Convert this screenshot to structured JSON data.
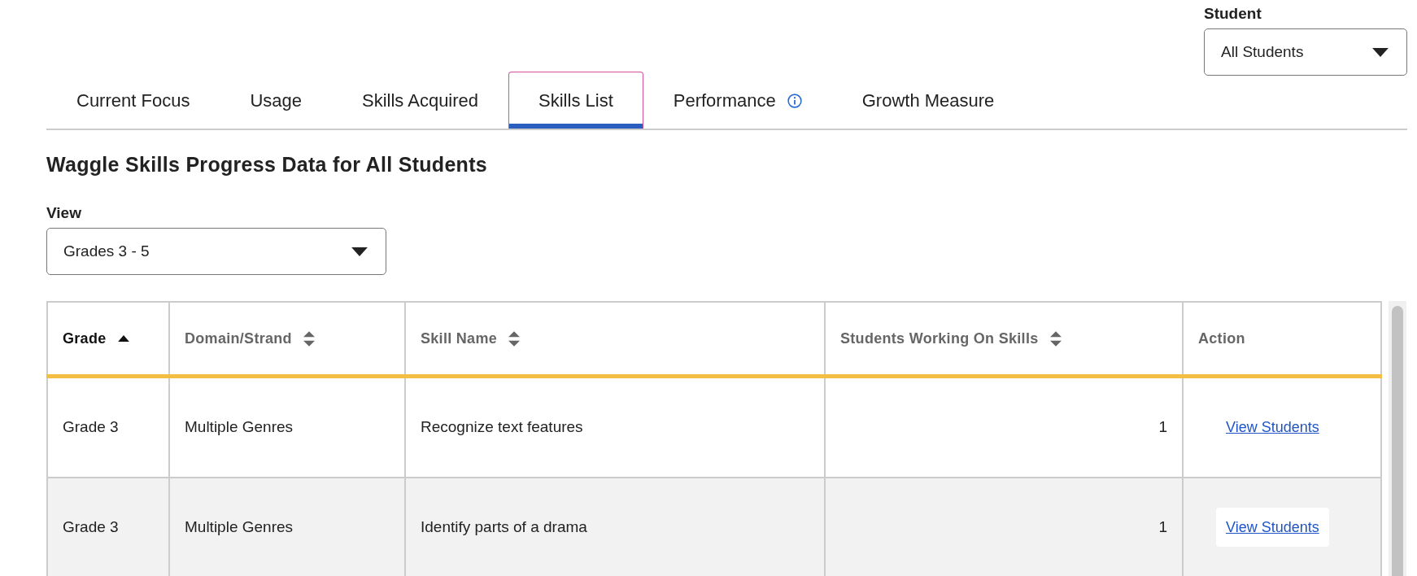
{
  "student_filter": {
    "label": "Student",
    "value": "All Students"
  },
  "tabs": [
    {
      "label": "Current Focus",
      "selected": false,
      "info": false
    },
    {
      "label": "Usage",
      "selected": false,
      "info": false
    },
    {
      "label": "Skills Acquired",
      "selected": false,
      "info": false
    },
    {
      "label": "Skills List",
      "selected": true,
      "info": false
    },
    {
      "label": "Performance",
      "selected": false,
      "info": true
    },
    {
      "label": "Growth Measure",
      "selected": false,
      "info": false
    }
  ],
  "heading": "Waggle Skills Progress Data for All Students",
  "view_filter": {
    "label": "View",
    "value": "Grades 3 - 5"
  },
  "table": {
    "columns": [
      {
        "label": "Grade",
        "sortable": true,
        "sorted": true
      },
      {
        "label": "Domain/Strand",
        "sortable": true,
        "sorted": false
      },
      {
        "label": "Skill Name",
        "sortable": true,
        "sorted": false
      },
      {
        "label": "Students Working On Skills",
        "sortable": true,
        "sorted": false
      },
      {
        "label": "Action",
        "sortable": false,
        "sorted": false
      }
    ],
    "rows": [
      {
        "grade": "Grade 3",
        "domain": "Multiple Genres",
        "skill": "Recognize text features",
        "students": "1",
        "action": "View Students",
        "highlighted": false
      },
      {
        "grade": "Grade 3",
        "domain": "Multiple Genres",
        "skill": "Identify parts of a drama",
        "students": "1",
        "action": "View Students",
        "highlighted": true
      }
    ]
  }
}
